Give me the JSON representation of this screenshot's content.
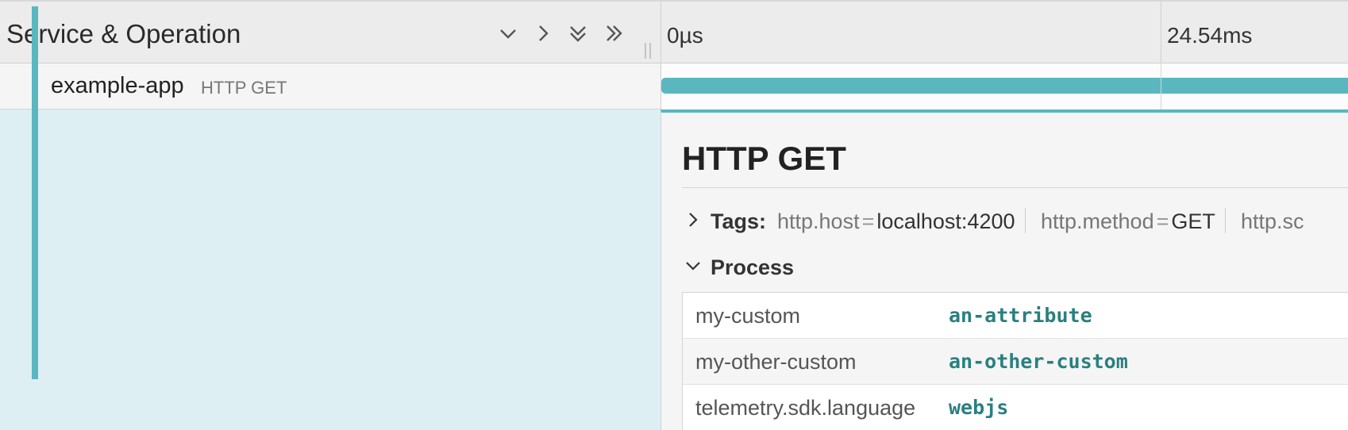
{
  "header": {
    "title": "Service & Operation",
    "icons": [
      "collapse-one-icon",
      "expand-one-icon",
      "collapse-all-icon",
      "expand-all-icon"
    ],
    "ticks": [
      "0µs",
      "24.54ms"
    ]
  },
  "span": {
    "service": "example-app",
    "operation": "HTTP GET",
    "bar_color": "#5ab7bf"
  },
  "detail": {
    "title": "HTTP GET",
    "tags_label": "Tags:",
    "tags": [
      {
        "key": "http.host",
        "value": "localhost:4200"
      },
      {
        "key": "http.method",
        "value": "GET"
      },
      {
        "key": "http.sc",
        "value": ""
      }
    ],
    "process_label": "Process",
    "process": [
      {
        "key": "my-custom",
        "value": "an-attribute"
      },
      {
        "key": "my-other-custom",
        "value": "an-other-custom"
      },
      {
        "key": "telemetry.sdk.language",
        "value": "webjs"
      }
    ]
  },
  "colors": {
    "accent": "#5ab7bf",
    "selected_bg": "#ddeff3",
    "value_text": "#2a7f7f"
  }
}
